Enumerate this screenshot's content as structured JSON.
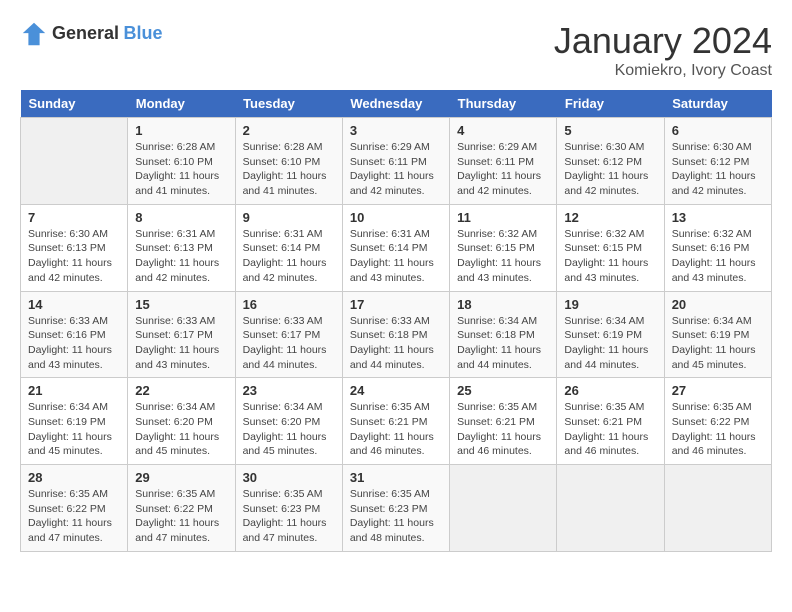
{
  "logo": {
    "general": "General",
    "blue": "Blue"
  },
  "title": "January 2024",
  "location": "Komiekro, Ivory Coast",
  "days_header": [
    "Sunday",
    "Monday",
    "Tuesday",
    "Wednesday",
    "Thursday",
    "Friday",
    "Saturday"
  ],
  "weeks": [
    [
      {
        "day": "",
        "empty": true
      },
      {
        "day": "1",
        "sunrise": "Sunrise: 6:28 AM",
        "sunset": "Sunset: 6:10 PM",
        "daylight": "Daylight: 11 hours and 41 minutes."
      },
      {
        "day": "2",
        "sunrise": "Sunrise: 6:28 AM",
        "sunset": "Sunset: 6:10 PM",
        "daylight": "Daylight: 11 hours and 41 minutes."
      },
      {
        "day": "3",
        "sunrise": "Sunrise: 6:29 AM",
        "sunset": "Sunset: 6:11 PM",
        "daylight": "Daylight: 11 hours and 42 minutes."
      },
      {
        "day": "4",
        "sunrise": "Sunrise: 6:29 AM",
        "sunset": "Sunset: 6:11 PM",
        "daylight": "Daylight: 11 hours and 42 minutes."
      },
      {
        "day": "5",
        "sunrise": "Sunrise: 6:30 AM",
        "sunset": "Sunset: 6:12 PM",
        "daylight": "Daylight: 11 hours and 42 minutes."
      },
      {
        "day": "6",
        "sunrise": "Sunrise: 6:30 AM",
        "sunset": "Sunset: 6:12 PM",
        "daylight": "Daylight: 11 hours and 42 minutes."
      }
    ],
    [
      {
        "day": "7",
        "sunrise": "Sunrise: 6:30 AM",
        "sunset": "Sunset: 6:13 PM",
        "daylight": "Daylight: 11 hours and 42 minutes."
      },
      {
        "day": "8",
        "sunrise": "Sunrise: 6:31 AM",
        "sunset": "Sunset: 6:13 PM",
        "daylight": "Daylight: 11 hours and 42 minutes."
      },
      {
        "day": "9",
        "sunrise": "Sunrise: 6:31 AM",
        "sunset": "Sunset: 6:14 PM",
        "daylight": "Daylight: 11 hours and 42 minutes."
      },
      {
        "day": "10",
        "sunrise": "Sunrise: 6:31 AM",
        "sunset": "Sunset: 6:14 PM",
        "daylight": "Daylight: 11 hours and 43 minutes."
      },
      {
        "day": "11",
        "sunrise": "Sunrise: 6:32 AM",
        "sunset": "Sunset: 6:15 PM",
        "daylight": "Daylight: 11 hours and 43 minutes."
      },
      {
        "day": "12",
        "sunrise": "Sunrise: 6:32 AM",
        "sunset": "Sunset: 6:15 PM",
        "daylight": "Daylight: 11 hours and 43 minutes."
      },
      {
        "day": "13",
        "sunrise": "Sunrise: 6:32 AM",
        "sunset": "Sunset: 6:16 PM",
        "daylight": "Daylight: 11 hours and 43 minutes."
      }
    ],
    [
      {
        "day": "14",
        "sunrise": "Sunrise: 6:33 AM",
        "sunset": "Sunset: 6:16 PM",
        "daylight": "Daylight: 11 hours and 43 minutes."
      },
      {
        "day": "15",
        "sunrise": "Sunrise: 6:33 AM",
        "sunset": "Sunset: 6:17 PM",
        "daylight": "Daylight: 11 hours and 43 minutes."
      },
      {
        "day": "16",
        "sunrise": "Sunrise: 6:33 AM",
        "sunset": "Sunset: 6:17 PM",
        "daylight": "Daylight: 11 hours and 44 minutes."
      },
      {
        "day": "17",
        "sunrise": "Sunrise: 6:33 AM",
        "sunset": "Sunset: 6:18 PM",
        "daylight": "Daylight: 11 hours and 44 minutes."
      },
      {
        "day": "18",
        "sunrise": "Sunrise: 6:34 AM",
        "sunset": "Sunset: 6:18 PM",
        "daylight": "Daylight: 11 hours and 44 minutes."
      },
      {
        "day": "19",
        "sunrise": "Sunrise: 6:34 AM",
        "sunset": "Sunset: 6:19 PM",
        "daylight": "Daylight: 11 hours and 44 minutes."
      },
      {
        "day": "20",
        "sunrise": "Sunrise: 6:34 AM",
        "sunset": "Sunset: 6:19 PM",
        "daylight": "Daylight: 11 hours and 45 minutes."
      }
    ],
    [
      {
        "day": "21",
        "sunrise": "Sunrise: 6:34 AM",
        "sunset": "Sunset: 6:19 PM",
        "daylight": "Daylight: 11 hours and 45 minutes."
      },
      {
        "day": "22",
        "sunrise": "Sunrise: 6:34 AM",
        "sunset": "Sunset: 6:20 PM",
        "daylight": "Daylight: 11 hours and 45 minutes."
      },
      {
        "day": "23",
        "sunrise": "Sunrise: 6:34 AM",
        "sunset": "Sunset: 6:20 PM",
        "daylight": "Daylight: 11 hours and 45 minutes."
      },
      {
        "day": "24",
        "sunrise": "Sunrise: 6:35 AM",
        "sunset": "Sunset: 6:21 PM",
        "daylight": "Daylight: 11 hours and 46 minutes."
      },
      {
        "day": "25",
        "sunrise": "Sunrise: 6:35 AM",
        "sunset": "Sunset: 6:21 PM",
        "daylight": "Daylight: 11 hours and 46 minutes."
      },
      {
        "day": "26",
        "sunrise": "Sunrise: 6:35 AM",
        "sunset": "Sunset: 6:21 PM",
        "daylight": "Daylight: 11 hours and 46 minutes."
      },
      {
        "day": "27",
        "sunrise": "Sunrise: 6:35 AM",
        "sunset": "Sunset: 6:22 PM",
        "daylight": "Daylight: 11 hours and 46 minutes."
      }
    ],
    [
      {
        "day": "28",
        "sunrise": "Sunrise: 6:35 AM",
        "sunset": "Sunset: 6:22 PM",
        "daylight": "Daylight: 11 hours and 47 minutes."
      },
      {
        "day": "29",
        "sunrise": "Sunrise: 6:35 AM",
        "sunset": "Sunset: 6:22 PM",
        "daylight": "Daylight: 11 hours and 47 minutes."
      },
      {
        "day": "30",
        "sunrise": "Sunrise: 6:35 AM",
        "sunset": "Sunset: 6:23 PM",
        "daylight": "Daylight: 11 hours and 47 minutes."
      },
      {
        "day": "31",
        "sunrise": "Sunrise: 6:35 AM",
        "sunset": "Sunset: 6:23 PM",
        "daylight": "Daylight: 11 hours and 48 minutes."
      },
      {
        "day": "",
        "empty": true
      },
      {
        "day": "",
        "empty": true
      },
      {
        "day": "",
        "empty": true
      }
    ]
  ]
}
